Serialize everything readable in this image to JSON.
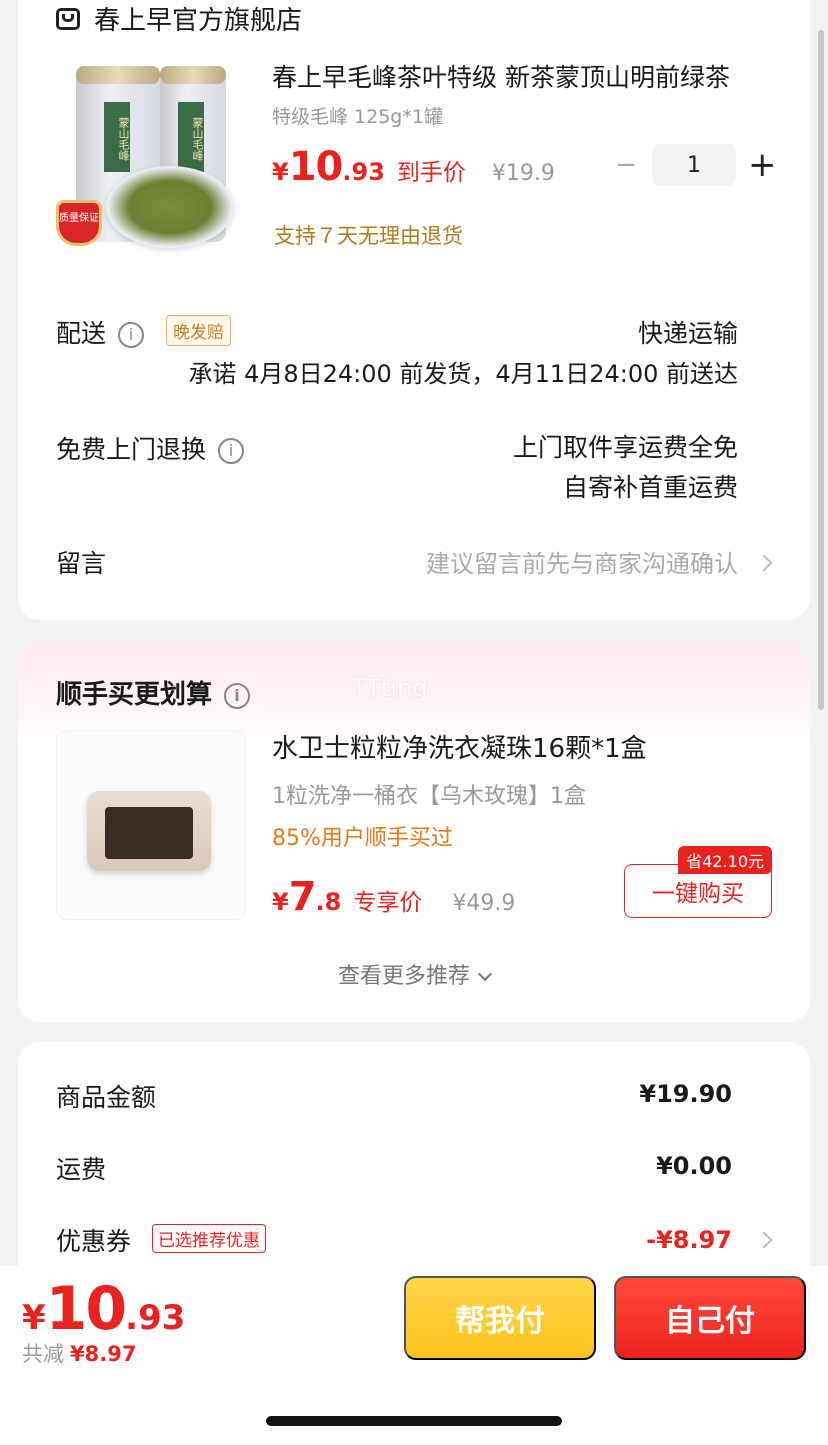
{
  "shop": {
    "name": "春上早官方旗舰店"
  },
  "product": {
    "title": "春上早毛峰茶叶特级 新茶蒙顶山明前绿茶",
    "spec": "特级毛峰 125g*1罐",
    "price_symbol": "¥",
    "price_int": "10",
    "price_dec": ".93",
    "price_tag": "到手价",
    "original_price": "¥19.9",
    "quantity": "1",
    "minus": "−",
    "plus": "+",
    "return_policy": "支持７天无理由退货",
    "image": {
      "can_label": "蒙山毛峰",
      "badge": "质量保证"
    }
  },
  "delivery": {
    "label": "配送",
    "tag": "晚发赔",
    "method": "快递运输",
    "promise": "承诺 4月8日24:00 前发货，4月11日24:00 前送达"
  },
  "free_return": {
    "label": "免费上门退换",
    "line1": "上门取件享运费全免",
    "line2": "自寄补首重运费"
  },
  "message": {
    "label": "留言",
    "placeholder": "建议留言前先与商家沟通确认"
  },
  "recommend": {
    "title": "顺手买更划算",
    "watermark": "TTting",
    "item": {
      "name": "水卫士粒粒净洗衣凝珠16颗*1盒",
      "sub": "1粒洗净一桶衣【乌木玫瑰】1盒",
      "social": "85%用户顺手买过",
      "price_symbol": "¥",
      "price_int": "7",
      "price_dec": ".8",
      "price_tag": "专享价",
      "original_price": "¥49.9",
      "save_tag": "省42.10元",
      "buy_label": "一键购买"
    },
    "more": "查看更多推荐"
  },
  "summary": {
    "goods_label": "商品金额",
    "goods_value": "¥19.90",
    "shipping_label": "运费",
    "shipping_value": "¥0.00",
    "coupon_label": "优惠券",
    "coupon_tag": "已选推荐优惠",
    "coupon_value": "-¥8.97"
  },
  "bottom": {
    "price_symbol": "¥",
    "price_int": "10",
    "price_dec": ".93",
    "discount_label": "共减",
    "discount_value": "¥8.97",
    "help_pay": "帮我付",
    "self_pay": "自己付"
  },
  "colors": {
    "accent_red": "#e8231f",
    "help_yellow": "#ffc21b",
    "gold_text": "#b4791d"
  }
}
